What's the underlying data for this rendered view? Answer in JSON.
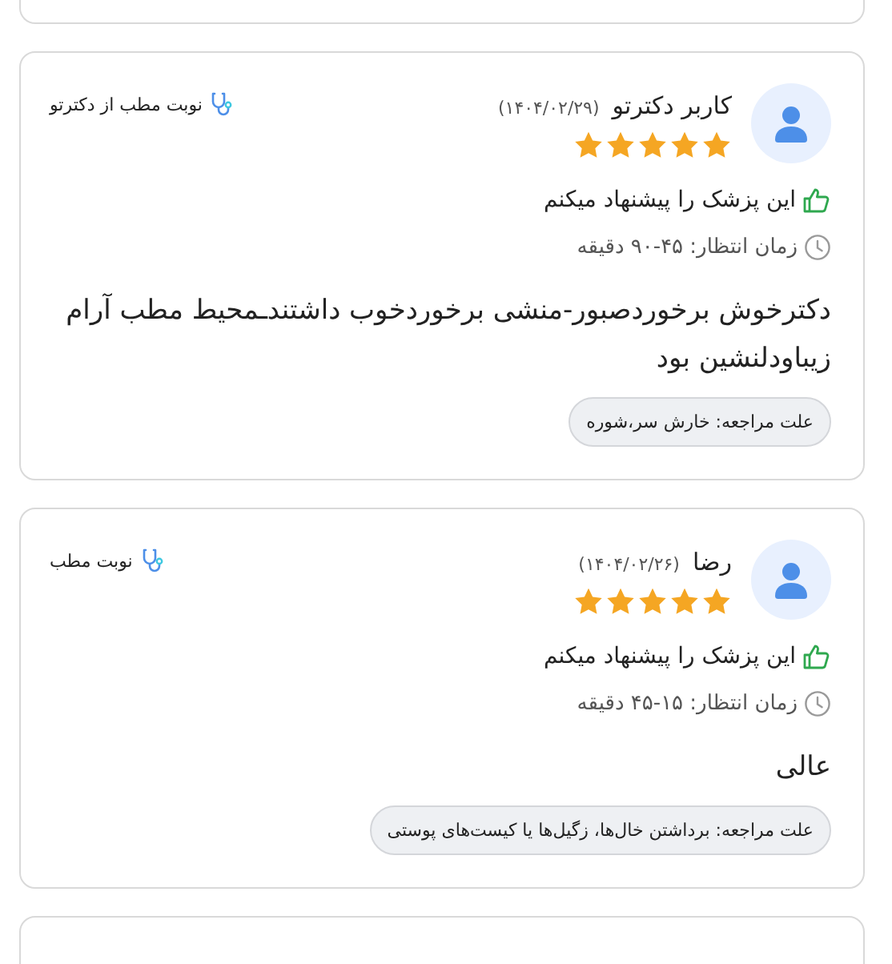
{
  "reviews": [
    {
      "name": "کاربر دکترتو",
      "date": "(۱۴۰۴/۰۲/۲۹)",
      "stars": 5,
      "source": "نوبت مطب از دکترتو",
      "recommended": true,
      "recommend_text": "این پزشک را پیشنهاد میکنم",
      "wait_time": "زمان انتظار: ۴۵-۹۰ دقیقه",
      "comment": "دکترخوش برخوردصبور-منشی برخوردخوب داشتندـمحیط مطب آرام زیباودلنشین بود",
      "reason": "علت مراجعه: خارش سر،شوره"
    },
    {
      "name": "رضا",
      "date": "(۱۴۰۴/۰۲/۲۶)",
      "stars": 5,
      "source": "نوبت مطب",
      "recommended": true,
      "recommend_text": "این پزشک را پیشنهاد میکنم",
      "wait_time": "زمان انتظار: ۱۵-۴۵ دقیقه",
      "comment": "عالی",
      "reason": "علت مراجعه: برداشتن خال‌ها، زگیل‌ها یا کیست‌های پوستی"
    }
  ]
}
